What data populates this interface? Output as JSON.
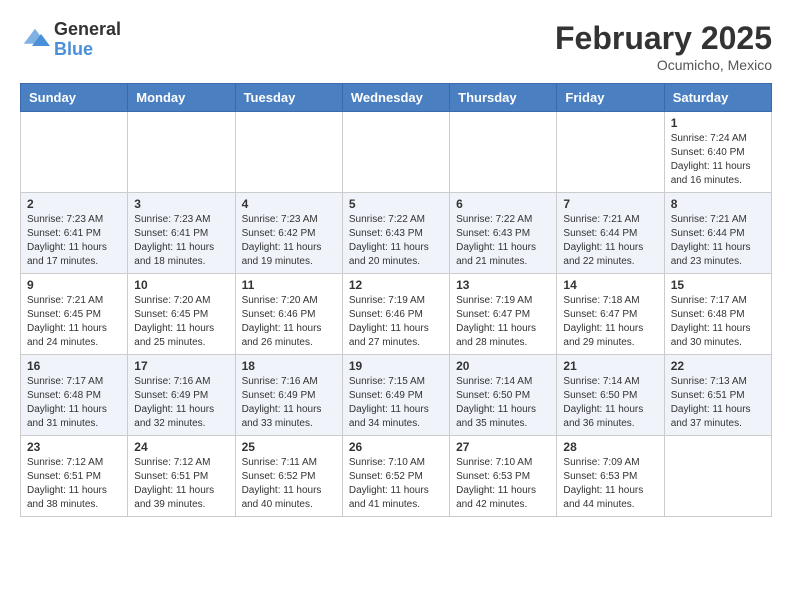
{
  "header": {
    "logo": {
      "general": "General",
      "blue": "Blue"
    },
    "title": "February 2025",
    "subtitle": "Ocumicho, Mexico"
  },
  "columns": [
    "Sunday",
    "Monday",
    "Tuesday",
    "Wednesday",
    "Thursday",
    "Friday",
    "Saturday"
  ],
  "weeks": [
    [
      null,
      null,
      null,
      null,
      null,
      null,
      {
        "day": 1,
        "sunrise": "7:24 AM",
        "sunset": "6:40 PM",
        "daylight": "11 hours and 16 minutes."
      }
    ],
    [
      {
        "day": 2,
        "sunrise": "7:23 AM",
        "sunset": "6:41 PM",
        "daylight": "11 hours and 17 minutes."
      },
      {
        "day": 3,
        "sunrise": "7:23 AM",
        "sunset": "6:41 PM",
        "daylight": "11 hours and 18 minutes."
      },
      {
        "day": 4,
        "sunrise": "7:23 AM",
        "sunset": "6:42 PM",
        "daylight": "11 hours and 19 minutes."
      },
      {
        "day": 5,
        "sunrise": "7:22 AM",
        "sunset": "6:43 PM",
        "daylight": "11 hours and 20 minutes."
      },
      {
        "day": 6,
        "sunrise": "7:22 AM",
        "sunset": "6:43 PM",
        "daylight": "11 hours and 21 minutes."
      },
      {
        "day": 7,
        "sunrise": "7:21 AM",
        "sunset": "6:44 PM",
        "daylight": "11 hours and 22 minutes."
      },
      {
        "day": 8,
        "sunrise": "7:21 AM",
        "sunset": "6:44 PM",
        "daylight": "11 hours and 23 minutes."
      }
    ],
    [
      {
        "day": 9,
        "sunrise": "7:21 AM",
        "sunset": "6:45 PM",
        "daylight": "11 hours and 24 minutes."
      },
      {
        "day": 10,
        "sunrise": "7:20 AM",
        "sunset": "6:45 PM",
        "daylight": "11 hours and 25 minutes."
      },
      {
        "day": 11,
        "sunrise": "7:20 AM",
        "sunset": "6:46 PM",
        "daylight": "11 hours and 26 minutes."
      },
      {
        "day": 12,
        "sunrise": "7:19 AM",
        "sunset": "6:46 PM",
        "daylight": "11 hours and 27 minutes."
      },
      {
        "day": 13,
        "sunrise": "7:19 AM",
        "sunset": "6:47 PM",
        "daylight": "11 hours and 28 minutes."
      },
      {
        "day": 14,
        "sunrise": "7:18 AM",
        "sunset": "6:47 PM",
        "daylight": "11 hours and 29 minutes."
      },
      {
        "day": 15,
        "sunrise": "7:17 AM",
        "sunset": "6:48 PM",
        "daylight": "11 hours and 30 minutes."
      }
    ],
    [
      {
        "day": 16,
        "sunrise": "7:17 AM",
        "sunset": "6:48 PM",
        "daylight": "11 hours and 31 minutes."
      },
      {
        "day": 17,
        "sunrise": "7:16 AM",
        "sunset": "6:49 PM",
        "daylight": "11 hours and 32 minutes."
      },
      {
        "day": 18,
        "sunrise": "7:16 AM",
        "sunset": "6:49 PM",
        "daylight": "11 hours and 33 minutes."
      },
      {
        "day": 19,
        "sunrise": "7:15 AM",
        "sunset": "6:49 PM",
        "daylight": "11 hours and 34 minutes."
      },
      {
        "day": 20,
        "sunrise": "7:14 AM",
        "sunset": "6:50 PM",
        "daylight": "11 hours and 35 minutes."
      },
      {
        "day": 21,
        "sunrise": "7:14 AM",
        "sunset": "6:50 PM",
        "daylight": "11 hours and 36 minutes."
      },
      {
        "day": 22,
        "sunrise": "7:13 AM",
        "sunset": "6:51 PM",
        "daylight": "11 hours and 37 minutes."
      }
    ],
    [
      {
        "day": 23,
        "sunrise": "7:12 AM",
        "sunset": "6:51 PM",
        "daylight": "11 hours and 38 minutes."
      },
      {
        "day": 24,
        "sunrise": "7:12 AM",
        "sunset": "6:51 PM",
        "daylight": "11 hours and 39 minutes."
      },
      {
        "day": 25,
        "sunrise": "7:11 AM",
        "sunset": "6:52 PM",
        "daylight": "11 hours and 40 minutes."
      },
      {
        "day": 26,
        "sunrise": "7:10 AM",
        "sunset": "6:52 PM",
        "daylight": "11 hours and 41 minutes."
      },
      {
        "day": 27,
        "sunrise": "7:10 AM",
        "sunset": "6:53 PM",
        "daylight": "11 hours and 42 minutes."
      },
      {
        "day": 28,
        "sunrise": "7:09 AM",
        "sunset": "6:53 PM",
        "daylight": "11 hours and 44 minutes."
      },
      null
    ]
  ],
  "labels": {
    "sunrise": "Sunrise:",
    "sunset": "Sunset:",
    "daylight": "Daylight:"
  }
}
